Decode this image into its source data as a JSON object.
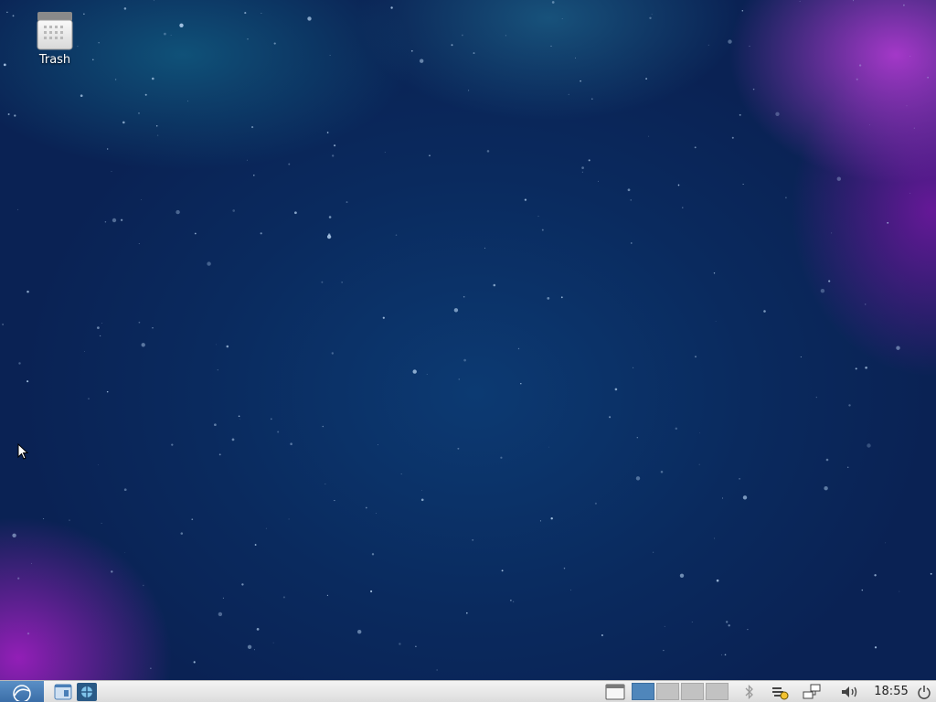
{
  "desktop": {
    "icons": [
      {
        "label": "Trash",
        "icon": "trash-icon"
      }
    ]
  },
  "panel": {
    "menu_icon": "menu-logo-icon",
    "launchers": [
      {
        "icon": "file-manager-icon"
      },
      {
        "icon": "web-browser-icon"
      }
    ],
    "workspaces": {
      "count": 4,
      "active": 1
    },
    "tray": [
      "bluetooth-icon",
      "update-notifier-icon",
      "network-icon",
      "volume-icon"
    ],
    "clock": "18:55",
    "power_icon": "power-icon"
  },
  "colors": {
    "panel_bg": "#e6e6e6",
    "menu_button": "#4a7fb8",
    "active_workspace": "#4f86bb",
    "desktop_base": "#0b2a5c",
    "nebula_purple": "#b43ad8"
  }
}
